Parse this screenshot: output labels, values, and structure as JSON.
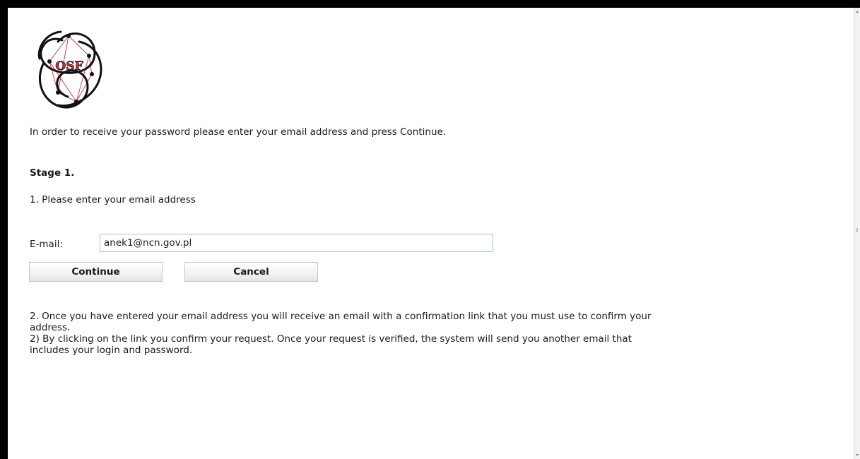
{
  "logo": {
    "text": "OSF"
  },
  "intro_text": "In order to receive your password please enter your email address and press Continue.",
  "stage": {
    "title": "Stage 1.",
    "step1": "1. Please enter your email address"
  },
  "form": {
    "email_label": "E-mail:",
    "email_value": "anek1@ncn.gov.pl"
  },
  "buttons": {
    "continue_label": "Continue",
    "cancel_label": "Cancel"
  },
  "info": {
    "step2": "2. Once you have entered your email address you will receive an email with a confirmation link that you must use to confirm your address.",
    "step2b": "2) By clicking on the link you confirm your request. Once your request is verified, the system will send you another email that includes your login and password."
  },
  "colors": {
    "logo_red": "#cc3333",
    "logo_dark": "#111111",
    "input_border": "#a8c2d6"
  }
}
